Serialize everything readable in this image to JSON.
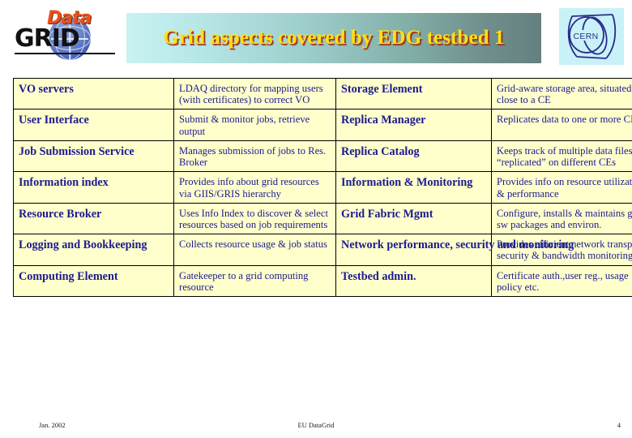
{
  "slide": {
    "title": "Grid aspects covered by EDG testbed 1",
    "logo_left": {
      "word_top": "Data",
      "word_bottom": "GRID"
    },
    "logo_right": {
      "text": "CERN"
    }
  },
  "colors": {
    "title_text": "#ffe013",
    "title_shadow": "#b03015",
    "banner_gradient_start": "#c9f2f2",
    "banner_gradient_end": "#657f80",
    "table_cell_bg": "#ffffcc",
    "table_text": "#1b1b8f",
    "table_border": "#000000",
    "logo_data_orange": "#e8521b",
    "logo_grid_black": "#111111",
    "cern_blue": "#2b2b8c",
    "cern_bg": "#c8f2f7"
  },
  "table": {
    "rows": [
      {
        "left_term": "VO servers",
        "left_desc": "LDAQ directory for mapping users (with certificates) to correct VO",
        "right_term": "Storage Element",
        "right_desc": "Grid-aware storage area, situated close to a CE"
      },
      {
        "left_term": "User Interface",
        "left_desc": "Submit & monitor jobs, retrieve output",
        "right_term": "Replica Manager",
        "right_desc": "Replicates data to one or more CEs"
      },
      {
        "left_term": "Job Submission Service",
        "left_desc": "Manages submission of jobs to Res. Broker",
        "right_term": "Replica Catalog",
        "right_desc": "Keeps track of multiple data files “replicated” on different CEs"
      },
      {
        "left_term": "Information index",
        "left_desc": "Provides info about grid resources via GIIS/GRIS hierarchy",
        "right_term": "Information  & Monitoring",
        "right_desc": "Provides info on resource utilization & performance"
      },
      {
        "left_term": "Resource Broker",
        "left_desc": "Uses Info Index to discover & select resources based on job requirements",
        "right_term": "Grid Fabric Mgmt",
        "right_desc": "Configure, installs & maintains grid sw packages and environ."
      },
      {
        "left_term": "Logging and Bookkeeping",
        "left_desc": "Collects resource usage & job status",
        "right_term": "Network performance, security and monitoring",
        "right_desc": "Provides efficient network transport, security & bandwidth monitoring"
      },
      {
        "left_term": "Computing Element",
        "left_desc": "Gatekeeper to a grid computing resource",
        "right_term": "Testbed admin.",
        "right_desc": "Certificate auth.,user reg., usage policy etc."
      }
    ]
  },
  "footer": {
    "date": "Jan. 2002",
    "center": "EU DataGrid",
    "page": "4"
  }
}
